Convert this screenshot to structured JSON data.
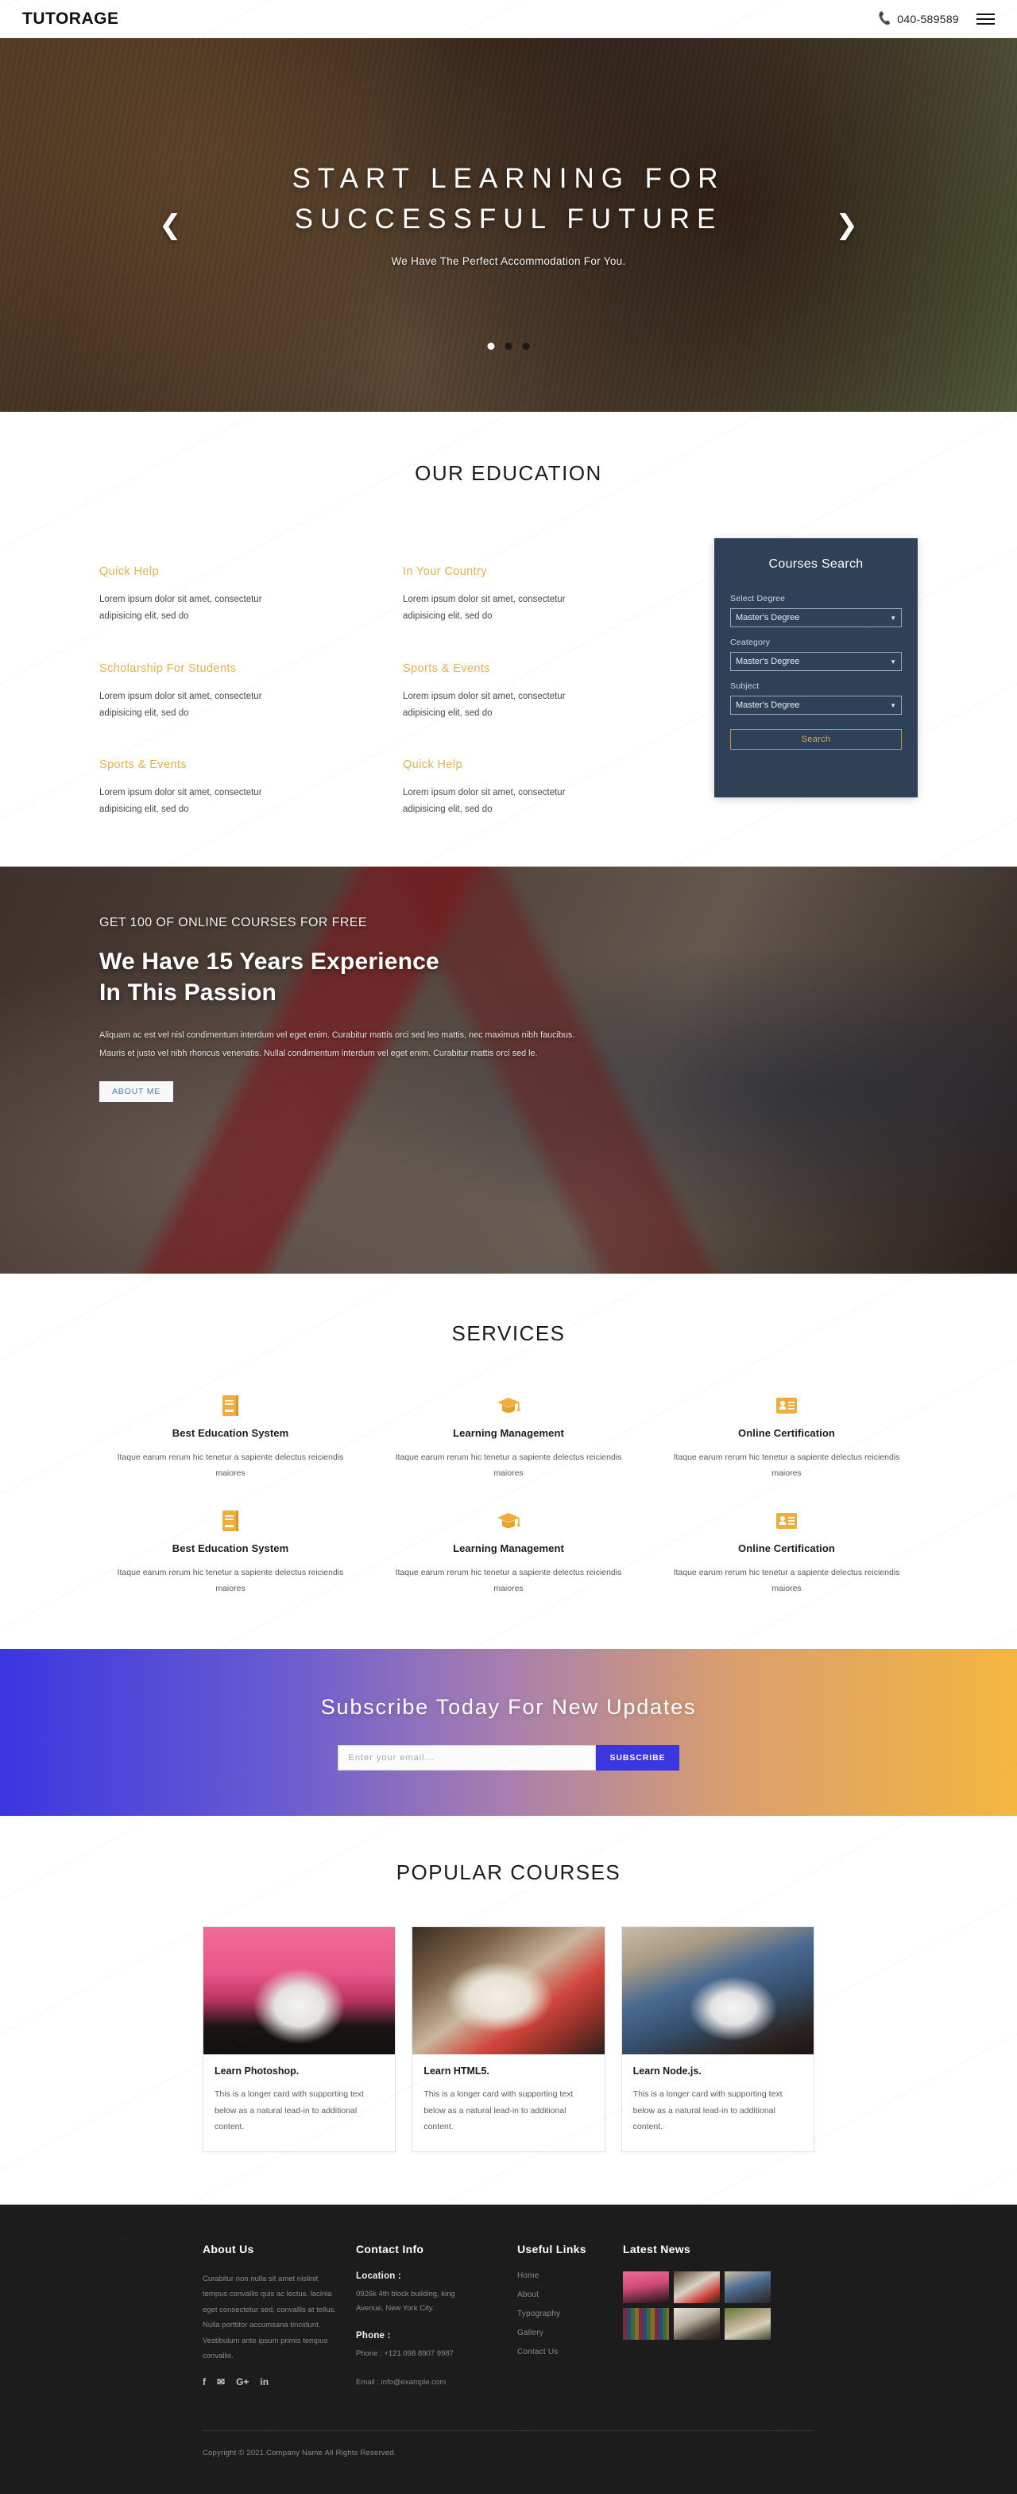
{
  "navbar": {
    "brand": "TUTORAGE",
    "phone": "040-589589",
    "phone_icon": "phone-icon",
    "menu_icon": "hamburger-menu-icon"
  },
  "hero": {
    "title_line1": "START LEARNING FOR",
    "title_line2": "SUCCESSFUL FUTURE",
    "subtitle": "We Have The Perfect Accommodation For You.",
    "prev_icon": "chevron-left-icon",
    "next_icon": "chevron-right-icon",
    "slide_count": 3,
    "active_slide": 1
  },
  "education": {
    "title": "OUR EDUCATION",
    "items": [
      {
        "heading": "Quick Help",
        "body": "Lorem ipsum dolor sit amet, consectetur adipisicing elit, sed do"
      },
      {
        "heading": "In Your Country",
        "body": "Lorem ipsum dolor sit amet, consectetur adipisicing elit, sed do"
      },
      {
        "heading": "Scholarship For Students",
        "body": "Lorem ipsum dolor sit amet, consectetur adipisicing elit, sed do"
      },
      {
        "heading": "Sports & Events",
        "body": "Lorem ipsum dolor sit amet, consectetur adipisicing elit, sed do"
      },
      {
        "heading": "Sports & Events",
        "body": "Lorem ipsum dolor sit amet, consectetur adipisicing elit, sed do"
      },
      {
        "heading": "Quick Help",
        "body": "Lorem ipsum dolor sit amet, consectetur adipisicing elit, sed do"
      }
    ],
    "search_panel": {
      "title": "Courses Search",
      "fields": [
        {
          "label": "Select Degree",
          "value": "Master's Degree"
        },
        {
          "label": "Ceategory",
          "value": "Master's Degree"
        },
        {
          "label": "Subject",
          "value": "Master's Degree"
        }
      ],
      "button_label": "Search",
      "accent_color": "#c8952e",
      "panel_color": "#2e4157"
    }
  },
  "experience": {
    "kicker": "GET 100 OF ONLINE COURSES FOR FREE",
    "heading_line1": "We Have 15 Years Experience",
    "heading_line2": "In This Passion",
    "paragraph": "Aliquam ac est vel nisl condimentum interdum vel eget enim. Curabitur mattis orci sed leo mattis, nec maximus nibh faucibus. Mauris et justo vel nibh rhoncus venenatis. Nullal condimentum interdum vel eget enim. Curabitur mattis orci sed le.",
    "button_label": "ABOUT ME"
  },
  "services": {
    "title": "SERVICES",
    "items": [
      {
        "icon": "book-icon",
        "heading": "Best Education System",
        "body": "Itaque earum rerum hic tenetur a sapiente delectus reiciendis maiores"
      },
      {
        "icon": "graduation-cap-icon",
        "heading": "Learning Management",
        "body": "Itaque earum rerum hic tenetur a sapiente delectus reiciendis maiores"
      },
      {
        "icon": "id-card-icon",
        "heading": "Online Certification",
        "body": "Itaque earum rerum hic tenetur a sapiente delectus reiciendis maiores"
      },
      {
        "icon": "book-icon",
        "heading": "Best Education System",
        "body": "Itaque earum rerum hic tenetur a sapiente delectus reiciendis maiores"
      },
      {
        "icon": "graduation-cap-icon",
        "heading": "Learning Management",
        "body": "Itaque earum rerum hic tenetur a sapiente delectus reiciendis maiores"
      },
      {
        "icon": "id-card-icon",
        "heading": "Online Certification",
        "body": "Itaque earum rerum hic tenetur a sapiente delectus reiciendis maiores"
      }
    ],
    "icon_color": "#f0ad3c"
  },
  "subscribe": {
    "title": "Subscribe Today For New Updates",
    "input_placeholder": "Enter your email...",
    "input_value": "",
    "button_label": "SUBSCRIBE",
    "gradient_start": "#3a36e0",
    "gradient_end": "#f5b63f"
  },
  "popular": {
    "title": "POPULAR COURSES",
    "cards": [
      {
        "heading": "Learn Photoshop.",
        "body": "This is a longer card with supporting text below as a natural lead-in to additional content."
      },
      {
        "heading": "Learn HTML5.",
        "body": "This is a longer card with supporting text below as a natural lead-in to additional content."
      },
      {
        "heading": "Learn Node.js.",
        "body": "This is a longer card with supporting text below as a natural lead-in to additional content."
      }
    ]
  },
  "footer": {
    "about": {
      "title": "About Us",
      "body": "Curabitur non nulla sit amet nislinit tempus convallis quis ac lectus. lacinia eget consectetur sed, convallis at tellus. Nulla porttitor accumsana tincidunt. Vestibulum ante ipsum primis tempus convallis.",
      "social": [
        {
          "icon": "facebook-icon",
          "glyph": "f"
        },
        {
          "icon": "twitter-icon",
          "glyph": "✉"
        },
        {
          "icon": "google-plus-icon",
          "glyph": "G+"
        },
        {
          "icon": "linkedin-icon",
          "glyph": "in"
        }
      ]
    },
    "contact": {
      "title": "Contact Info",
      "location_label": "Location :",
      "location_value": "0926k 4th block building, king Avenue, New York City.",
      "phone_label": "Phone :",
      "phone_value": "Phone : +121 098 8907 9987",
      "email_value": "Email : info@example.com"
    },
    "links": {
      "title": "Useful Links",
      "items": [
        "Home",
        "About",
        "Typography",
        "Gallery",
        "Contact Us"
      ]
    },
    "news": {
      "title": "Latest News",
      "thumbs": [
        "news-thumb-1",
        "news-thumb-2",
        "news-thumb-3",
        "news-thumb-4",
        "news-thumb-5",
        "news-thumb-6"
      ]
    },
    "copyright": "Copyright © 2021.Company Name All Rights Reserved."
  }
}
